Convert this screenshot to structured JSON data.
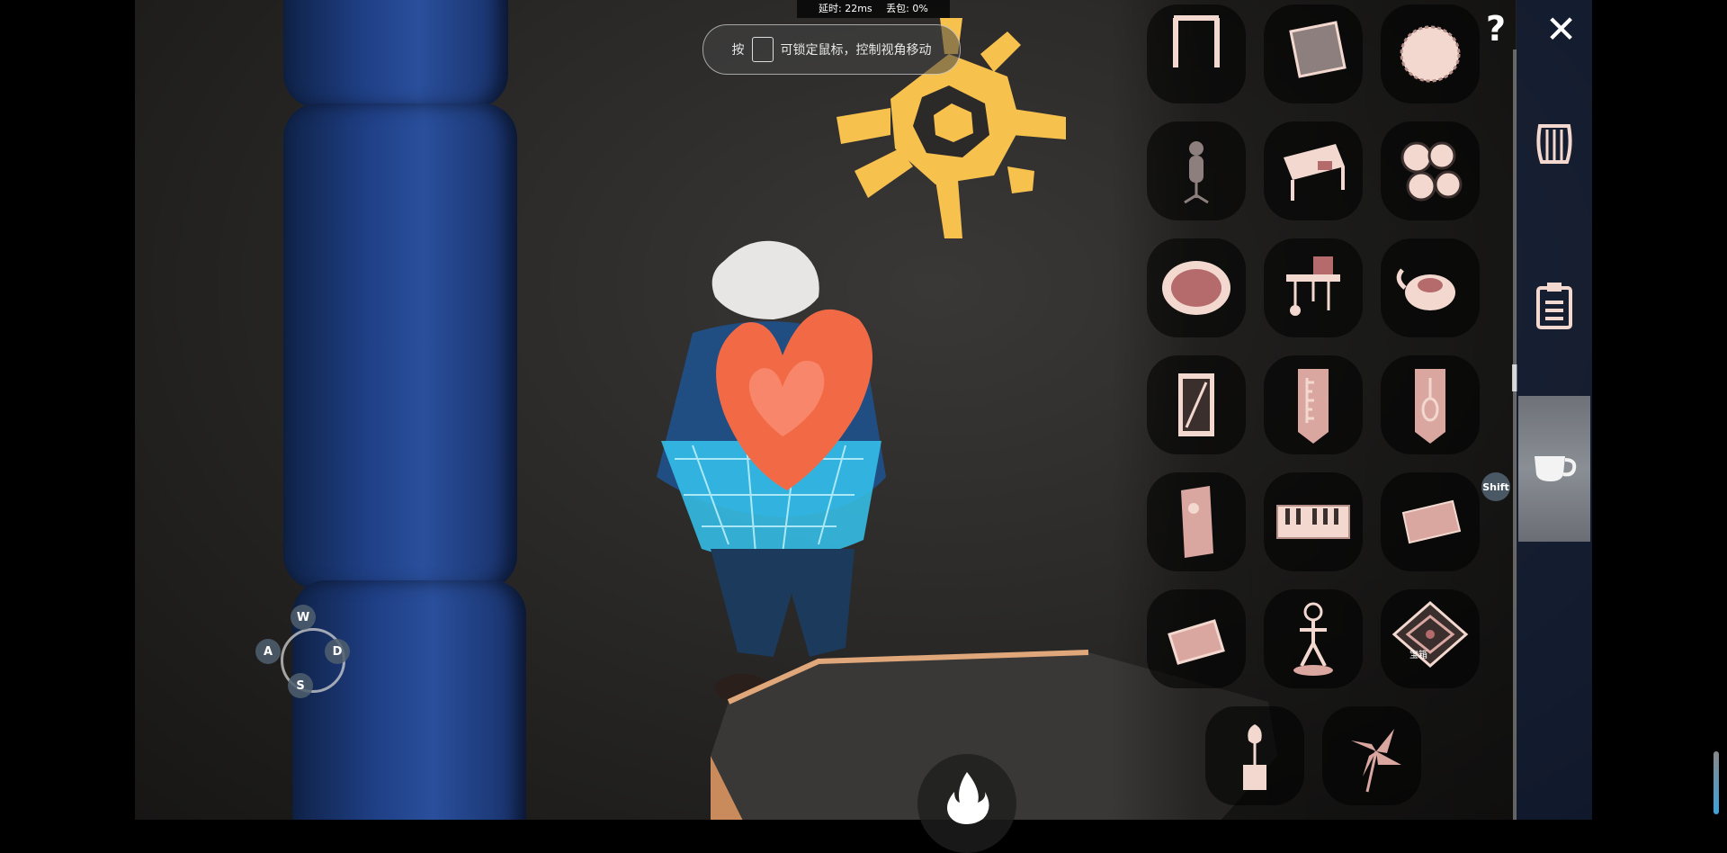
{
  "hud": {
    "latency_label": "延时: 22ms",
    "packet_loss_label": "丢包: 0%"
  },
  "lock_hint": {
    "prefix": "按",
    "text": "可锁定鼠标，控制视角移动"
  },
  "movement_keys": {
    "up": "W",
    "left": "A",
    "right": "D",
    "down": "S"
  },
  "panel": {
    "help_label": "?",
    "close_label": "✕",
    "shift_key": "Shift",
    "slot_caption": "宝箱",
    "items": [
      "stand-icon",
      "signboard-icon",
      "round-cushion-icon",
      "figure-stand-icon",
      "table-icon",
      "shell-pile-icon",
      "mirror-icon",
      "wall-shelf-icon",
      "teapot-icon",
      "card-icon",
      "ruler-banner-icon",
      "lute-banner-icon",
      "tall-card-icon",
      "piano-icon",
      "flat-cushion-icon",
      "tile-icon",
      "dancer-icon",
      "diamond-chest-icon",
      "flower-pot-icon",
      "pinwheel-icon"
    ]
  },
  "tabs": [
    "harp-tab",
    "clipboard-tab",
    "teacup-tab"
  ],
  "active_tab": "teacup-tab",
  "colors": {
    "accent": "#f7c14e",
    "item": "#f3d8cf",
    "heart": "#f26a45",
    "cape": "#35c5f0"
  }
}
